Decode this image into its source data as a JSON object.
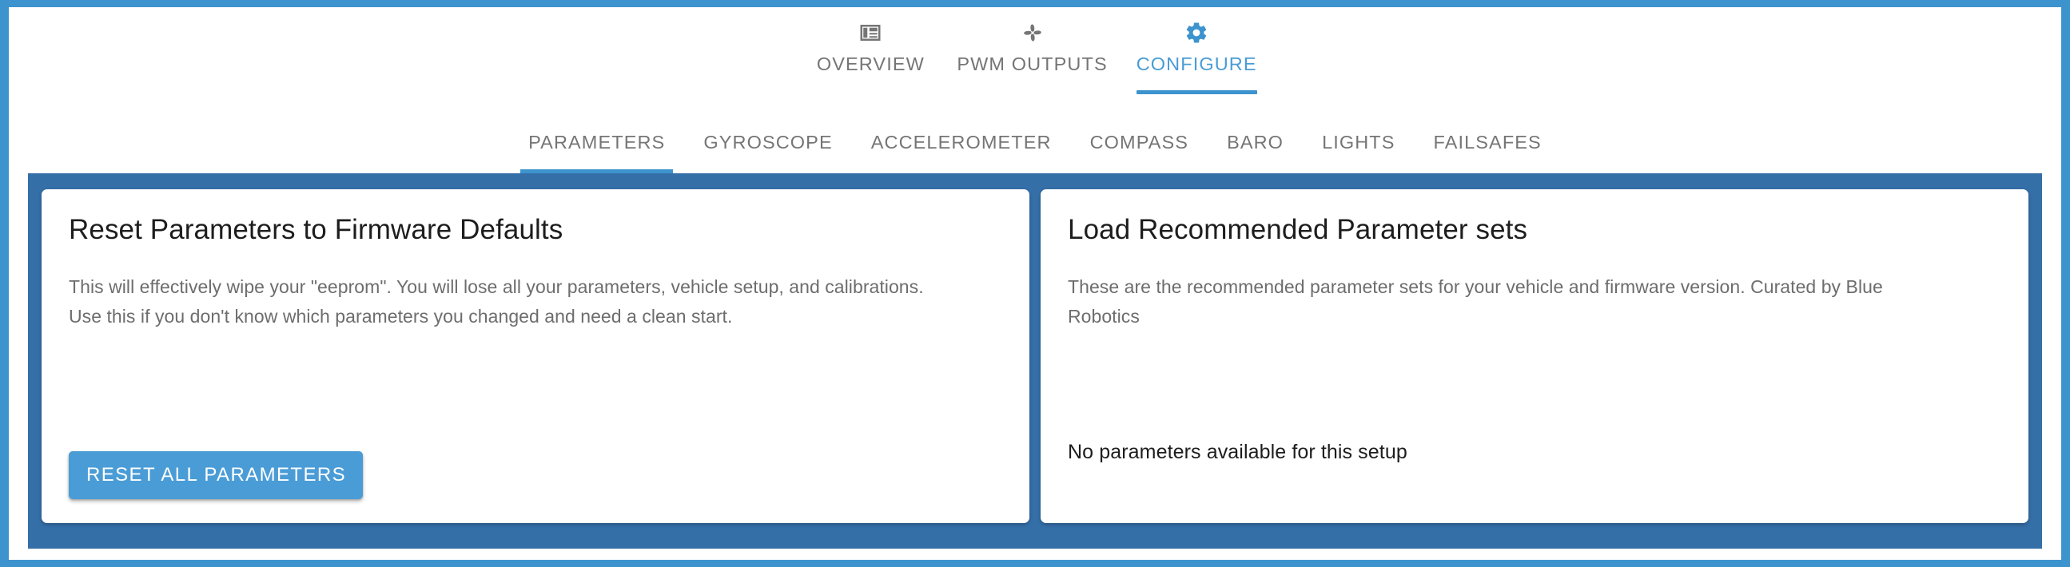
{
  "theme": {
    "window_border": "#3d93cd",
    "panel_background": "#356fa8",
    "accent": "#4a9cd6",
    "card_background": "#ffffff",
    "muted_text": "#757575",
    "body_text": "#6d6d6d"
  },
  "primary_nav": {
    "tabs": [
      {
        "label": "OVERVIEW",
        "icon": "dashboard-grid-icon",
        "active": false
      },
      {
        "label": "PWM OUTPUTS",
        "icon": "fan-propeller-icon",
        "active": false
      },
      {
        "label": "CONFIGURE",
        "icon": "gear-icon",
        "active": true
      }
    ]
  },
  "secondary_nav": {
    "tabs": [
      {
        "label": "PARAMETERS",
        "active": true
      },
      {
        "label": "GYROSCOPE",
        "active": false
      },
      {
        "label": "ACCELEROMETER",
        "active": false
      },
      {
        "label": "COMPASS",
        "active": false
      },
      {
        "label": "BARO",
        "active": false
      },
      {
        "label": "LIGHTS",
        "active": false
      },
      {
        "label": "FAILSAFES",
        "active": false
      }
    ]
  },
  "cards": {
    "reset": {
      "title": "Reset Parameters to Firmware Defaults",
      "body": "This will effectively wipe your \"eeprom\". You will lose all your parameters, vehicle setup, and calibrations. Use this if you don't know which parameters you changed and need a clean start.",
      "button_label": "RESET ALL PARAMETERS"
    },
    "load": {
      "title": "Load Recommended Parameter sets",
      "body": "These are the recommended parameter sets for your vehicle and firmware version. Curated by Blue Robotics",
      "status": "No parameters available for this setup"
    }
  }
}
